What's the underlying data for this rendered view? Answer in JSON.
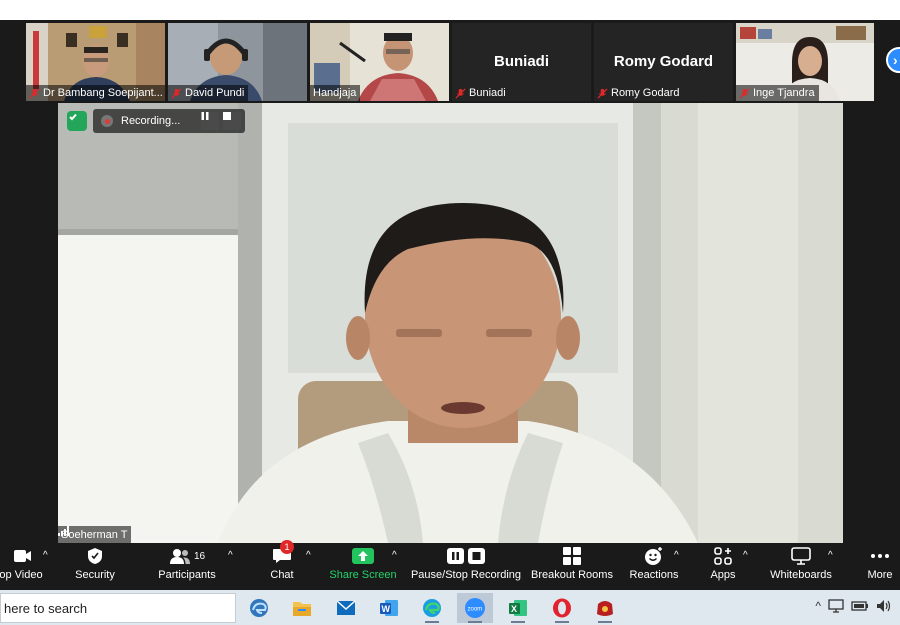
{
  "gallery": [
    {
      "name": "Dr Bambang Soepijant...",
      "muted": true
    },
    {
      "name": "David Pundi",
      "muted": true
    },
    {
      "name": "Handjaja",
      "muted": false
    },
    {
      "name": "Buniadi",
      "display_name": "Buniadi",
      "muted": true
    },
    {
      "name": "Romy Godard",
      "display_name": "Romy Godard",
      "muted": true
    },
    {
      "name": "Inge Tjandra",
      "muted": true
    }
  ],
  "recording": {
    "status": "Recording..."
  },
  "speaker": {
    "name": "Soeherman T"
  },
  "toolbar": {
    "stop_video": "op Video",
    "security": "Security",
    "participants": "Participants",
    "participants_count": "16",
    "chat": "Chat",
    "chat_badge": "1",
    "share_screen": "Share Screen",
    "recording": "Pause/Stop Recording",
    "breakout_rooms": "Breakout Rooms",
    "reactions": "Reactions",
    "apps": "Apps",
    "whiteboards": "Whiteboards",
    "more": "More"
  },
  "taskbar": {
    "search_text": "here to search",
    "apps": [
      "edge-dev-icon",
      "file-explorer-icon",
      "mail-icon",
      "word-icon",
      "edge-icon",
      "zoom-icon",
      "excel-icon",
      "opera-icon",
      "game-icon"
    ]
  },
  "colors": {
    "share_green": "#0e71eb",
    "accent_blue": "#2d8cff",
    "badge_red": "#e02828",
    "shield_green": "#23a55a"
  }
}
